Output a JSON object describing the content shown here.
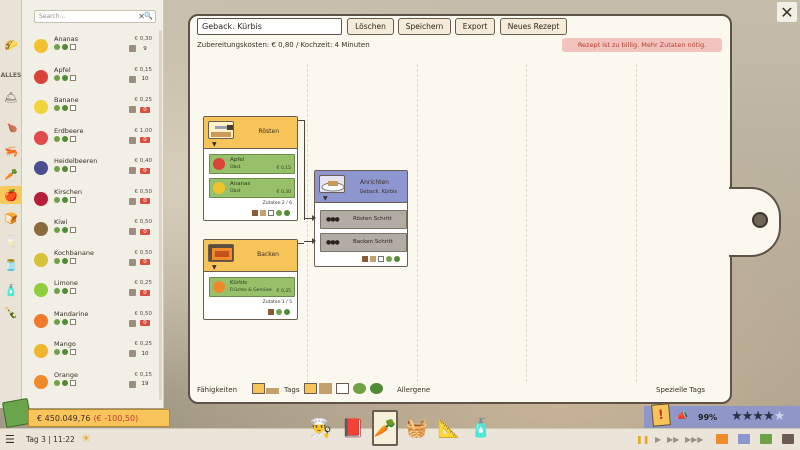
{
  "sidebar": {
    "search_placeholder": "Search...",
    "categories": [
      "ALLES"
    ],
    "ingredients": [
      {
        "name": "Ananas",
        "price": "€ 0,30",
        "stock": "9",
        "color": "#f2c22e"
      },
      {
        "name": "Apfel",
        "price": "€ 0,15",
        "stock": "10",
        "color": "#d9433a"
      },
      {
        "name": "Banane",
        "price": "€ 0,25",
        "stock": "0",
        "color": "#f1d33c"
      },
      {
        "name": "Erdbeere",
        "price": "€ 1,00",
        "stock": "0",
        "color": "#e04b4b"
      },
      {
        "name": "Heidelbeeren",
        "price": "€ 0,40",
        "stock": "0",
        "color": "#4a4f8f"
      },
      {
        "name": "Kirschen",
        "price": "€ 0,50",
        "stock": "0",
        "color": "#b51f3a"
      },
      {
        "name": "Kiwi",
        "price": "€ 0,50",
        "stock": "0",
        "color": "#8a6b3e"
      },
      {
        "name": "Kochbanane",
        "price": "€ 0,50",
        "stock": "0",
        "color": "#d6c13a"
      },
      {
        "name": "Limone",
        "price": "€ 0,25",
        "stock": "0",
        "color": "#8fcf3c"
      },
      {
        "name": "Mandarine",
        "price": "€ 0,50",
        "stock": "0",
        "color": "#f07a2a"
      },
      {
        "name": "Mango",
        "price": "€ 0,25",
        "stock": "10",
        "color": "#f0b72e"
      },
      {
        "name": "Orange",
        "price": "€ 0,15",
        "stock": "19",
        "color": "#f08b2a"
      }
    ]
  },
  "toolbar": {
    "recipe_name": "Geback. Kürbis",
    "delete_label": "Löschen",
    "save_label": "Speichern",
    "export_label": "Export",
    "new_label": "Neues Rezept"
  },
  "costs_text": "Zubereitungskosten: € 0,80 / Kochzeit: 4 Minuten",
  "warning_text": "Rezept ist zu billig. Mehr Zutaten nötig.",
  "steps": {
    "roast": {
      "title": "Rösten",
      "ingredients": [
        {
          "name": "Apfel",
          "type": "Obst",
          "price": "€ 0,15"
        },
        {
          "name": "Ananas",
          "type": "Obst",
          "price": "€ 0,30"
        }
      ],
      "count": "Zutaten 2 / 6"
    },
    "bake": {
      "title": "Backen",
      "ingredients": [
        {
          "name": "Kürbis",
          "type": "Früchte & Gemüse",
          "price": "€ 0,35"
        }
      ],
      "count": "Zutaten 1 / 5"
    },
    "serve": {
      "title": "Anrichten",
      "subtitle": "Geback. Kürbis",
      "sub_steps": [
        "Rösten Schritt",
        "Backen Schritt"
      ]
    }
  },
  "footer": {
    "skills_label": "Fähigkeiten",
    "tags_label": "Tags",
    "allergens_label": "Allergene",
    "special_tags_label": "Spezielle Tags"
  },
  "hud": {
    "money": "€ 450.049,76",
    "money_delta": "(€ -100,50)",
    "day_time": "Tag 3 | 11:22",
    "rating": "99%",
    "stars_filled": 4,
    "stars_total": 5
  },
  "colors": {
    "accent_yellow": "#f7c45a",
    "accent_blue": "#8e96cf",
    "ingredient_green": "#96c16a",
    "warning_red": "#b13e33"
  }
}
